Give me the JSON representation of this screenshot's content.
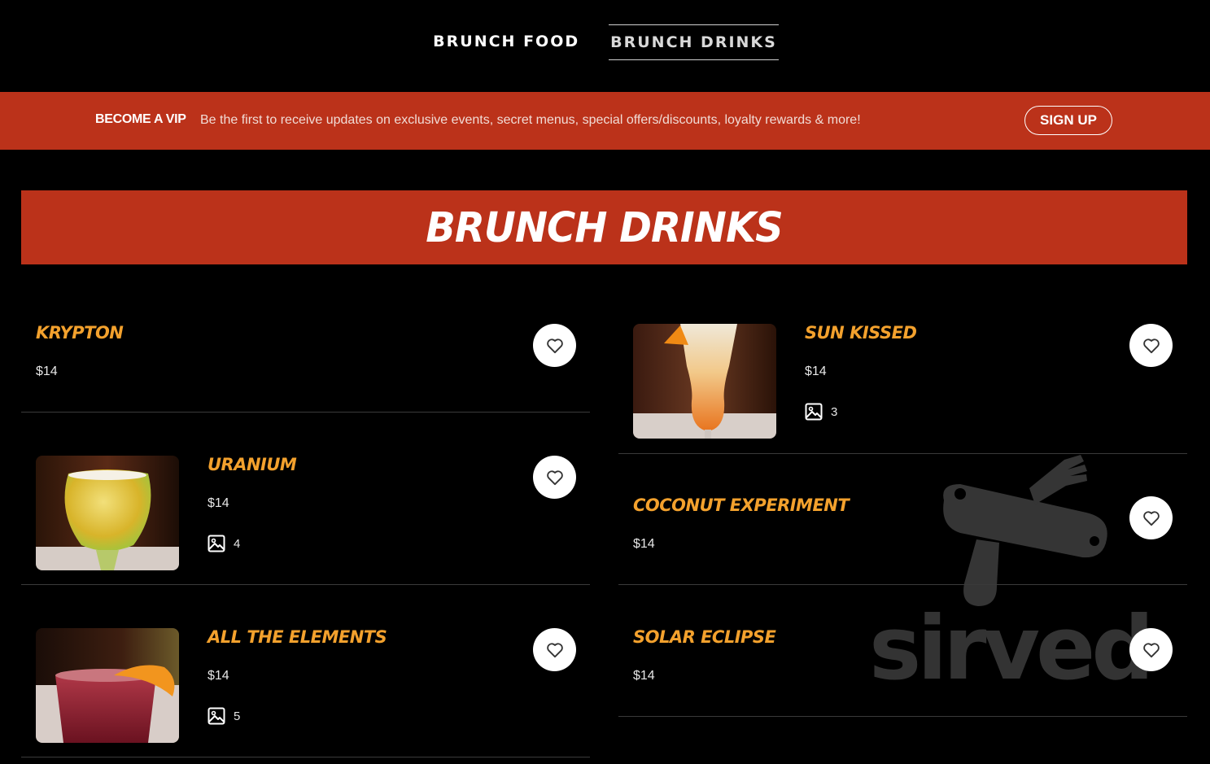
{
  "nav": {
    "tabs": [
      {
        "label": "BRUNCH FOOD"
      },
      {
        "label": "BRUNCH DRINKS"
      }
    ]
  },
  "vip": {
    "title": "BECOME A VIP",
    "text": "Be the first to receive updates on exclusive events, secret menus, special offers/discounts, loyalty rewards & more!",
    "signup_label": "SIGN UP"
  },
  "section": {
    "title": "BRUNCH DRINKS"
  },
  "watermark": {
    "word": "sirved"
  },
  "items": [
    {
      "name": "KRYPTON",
      "price": "$14"
    },
    {
      "name": "SUN KISSED",
      "price": "$14",
      "photo_count": "3"
    },
    {
      "name": "URANIUM",
      "price": "$14",
      "photo_count": "4"
    },
    {
      "name": "COCONUT EXPERIMENT",
      "price": "$14"
    },
    {
      "name": "ALL THE ELEMENTS",
      "price": "$14",
      "photo_count": "5"
    },
    {
      "name": "SOLAR ECLIPSE",
      "price": "$14"
    }
  ],
  "colors": {
    "accent": "#bb321a",
    "item_name": "#f3a12d",
    "background": "#000000"
  }
}
